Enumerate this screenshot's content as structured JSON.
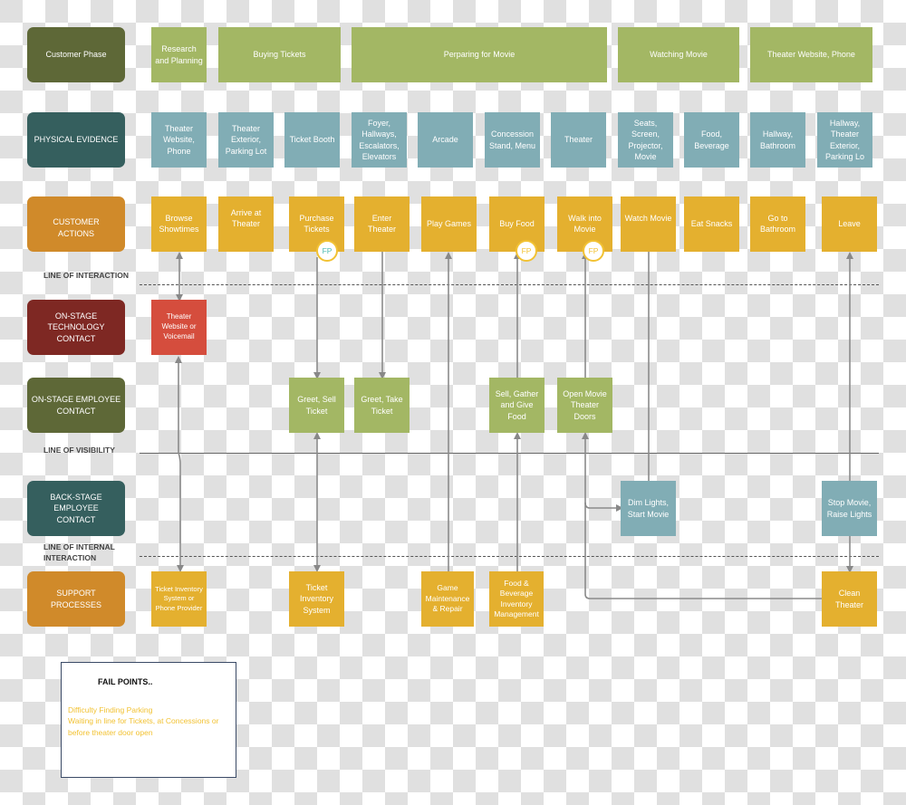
{
  "colors": {
    "phase_fill": "#a3b764",
    "evidence_fill": "#81adb5",
    "action_fill": "#e4b02f",
    "tech_fill": "#d54d3d",
    "onstage_fill": "#a3b764",
    "backstage_fill": "#81adb5",
    "support_fill": "#e4b02f",
    "fail_point_text": "#f2c233",
    "fp_teal": "#4cb8b0"
  },
  "lanes": {
    "customer_phase": {
      "label": "Customer Phase",
      "color": "#5e6837"
    },
    "physical_evidence": {
      "label": "PHYSICAL EVIDENCE",
      "color": "#355f5e"
    },
    "customer_actions": {
      "label": "CUSTOMER ACTIONS",
      "color": "#d08a2a"
    },
    "onstage_technology": {
      "label": "ON-STAGE TECHNOLOGY CONTACT",
      "color": "#7e2823"
    },
    "onstage_employee": {
      "label": "ON-STAGE EMPLOYEE CONTACT",
      "color": "#5e6837"
    },
    "backstage_employee": {
      "label": "BACK-STAGE EMPLOYEE CONTACT",
      "color": "#355f5e"
    },
    "support_processes": {
      "label": "SUPPORT PROCESSES",
      "color": "#d08a2a"
    }
  },
  "lines": {
    "interaction": "LINE OF INTERACTION",
    "visibility": "LINE OF VISIBILITY",
    "internal_interaction": "LINE OF INTERNAL INTERACTION"
  },
  "phases": [
    "Research and Planning",
    "Buying Tickets",
    "Perparing for Movie",
    "Watching Movie",
    "Theater Website, Phone"
  ],
  "evidence": [
    "Theater Website, Phone",
    "Theater Exterior, Parking Lot",
    "Ticket Booth",
    "Foyer, Hallways, Escalators, Elevators",
    "Arcade",
    "Concession Stand, Menu",
    "Theater",
    "Seats, Screen, Projector, Movie",
    "Food, Beverage",
    "Hallway, Bathroom",
    "Hallway, Theater Exterior, Parking Lo"
  ],
  "actions": [
    "Browse Showtimes",
    "Arrive at Theater",
    "Purchase Tickets",
    "Enter Theater",
    "Play Games",
    "Buy Food",
    "Walk into Movie",
    "Watch Movie",
    "Eat Snacks",
    "Go to Bathroom",
    "Leave"
  ],
  "fail_point_badge": "FP",
  "tech": [
    "Theater Website or Voicemail"
  ],
  "onstage": [
    "Greet, Sell Ticket",
    "Greet, Take Ticket",
    "Sell, Gather and Give Food",
    "Open Movie Theater Doors"
  ],
  "backstage": [
    "Dim Lights, Start Movie",
    "Stop Movie, Raise Lights"
  ],
  "support": [
    "Ticket Inventory System or Phone Provider",
    "Ticket Inventory System",
    "Game Maintenance & Repair",
    "Food & Beverage Inventory Management",
    "Clean Theater"
  ],
  "fail_points": {
    "title": "FAIL POINTS..",
    "items": [
      "Difficulty Finding Parking",
      "Waiting in line for Tickets, at Concessions or before theater door open"
    ]
  }
}
